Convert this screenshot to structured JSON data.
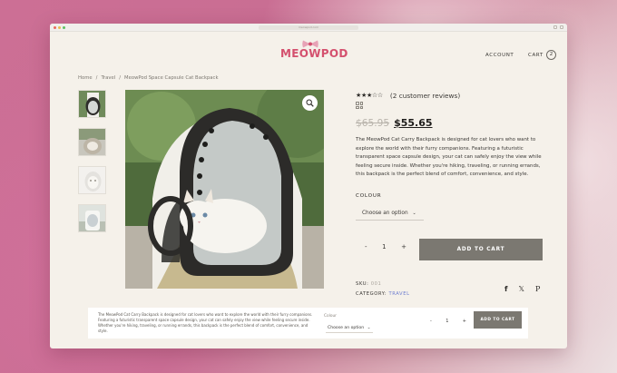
{
  "browser": {
    "url": "meowpod.com"
  },
  "brand": {
    "logo_text": "MEOWPOD",
    "accent": "#d4506e"
  },
  "nav": {
    "account": "ACCOUNT",
    "cart": "CART",
    "cart_count": "2"
  },
  "breadcrumb": [
    "Home",
    "/",
    "Travel",
    "/",
    "MeowPod Space Capsule Cat Backpack"
  ],
  "product": {
    "rating": 3,
    "rating_max": 5,
    "stars": "★★★☆☆",
    "reviews": "(2 customer reviews)",
    "old_price": "$65.95",
    "price": "$55.65",
    "description": "The MeowPod Cat Carry Backpack is designed for cat lovers who want to explore the world with their furry companions. Featuring a futuristic transparent space capsule design, your cat can safely enjoy the view while feeling secure inside. Whether you're hiking, traveling, or running errands, this backpack is the perfect blend of comfort, convenience, and style.",
    "colour_label": "COLOUR",
    "colour_placeholder": "Choose an option",
    "qty_minus": "-",
    "qty": "1",
    "qty_plus": "+",
    "add_to_cart": "ADD TO CART",
    "sku_label": "SKU:",
    "sku": "001",
    "category_label": "CATEGORY:",
    "category": "TRAVEL",
    "social": {
      "facebook": "f",
      "x": "𝕏",
      "pinterest": "P"
    }
  },
  "sticky_bar": {
    "description": "The MeowPod Cat Carry Backpack is designed for cat lovers who want to explore the world with their furry companions. Featuring a futuristic transparent space capsule design, your cat can safely enjoy the view while feeling secure inside. Whether you're hiking, traveling, or running errands, this backpack is the perfect blend of comfort, convenience, and style.",
    "colour_label": "Colour",
    "colour_placeholder": "Choose an option",
    "qty_minus": "-",
    "qty": "1",
    "qty_plus": "+",
    "add_to_cart": "ADD TO CART"
  }
}
